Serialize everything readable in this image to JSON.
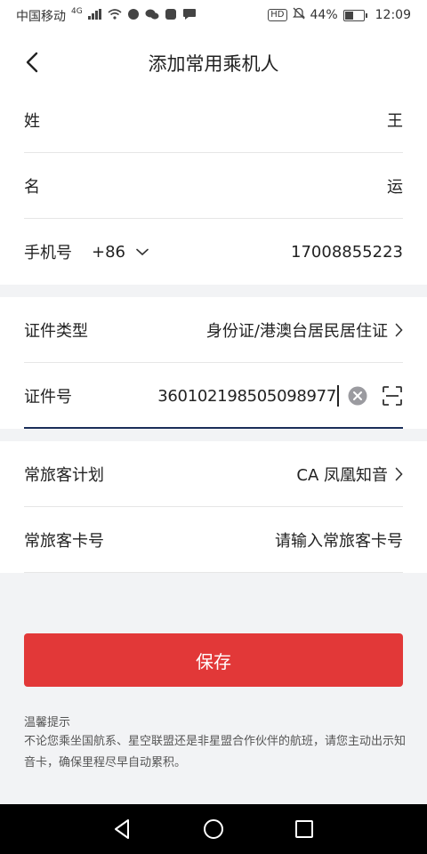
{
  "status_bar": {
    "carrier": "中国移动",
    "network": "4G",
    "battery": "44%",
    "battery_level": 0.44,
    "time": "12:09",
    "hd": "HD"
  },
  "header": {
    "title": "添加常用乘机人"
  },
  "form": {
    "surname_label": "姓",
    "surname_value": "王",
    "given_name_label": "名",
    "given_name_value": "运",
    "phone_label": "手机号",
    "country_code": "+86",
    "phone_value": "17008855223",
    "id_type_label": "证件类型",
    "id_type_value": "身份证/港澳台居民居住证",
    "id_number_label": "证件号",
    "id_number_value": "360102198505098977",
    "ff_program_label": "常旅客计划",
    "ff_program_value": "CA 凤凰知音",
    "ff_card_label": "常旅客卡号",
    "ff_card_placeholder": "请输入常旅客卡号"
  },
  "save_button": "保存",
  "tips": {
    "title": "温馨提示",
    "body": "不论您乘坐国航系、星空联盟还是非星盟合作伙伴的航班，请您主动出示知音卡，确保里程尽早自动累积。"
  },
  "colors": {
    "accent": "#e23838",
    "focus_underline": "#1b2f5a"
  }
}
